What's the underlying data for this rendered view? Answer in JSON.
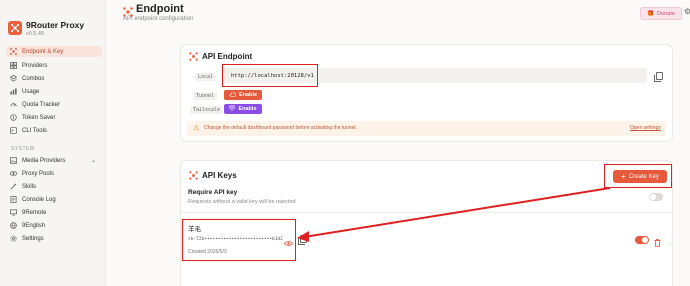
{
  "window": {
    "dot_colors": [
      "#ff5f57",
      "#febc2e",
      "#28c840"
    ]
  },
  "app": {
    "name": "9Router Proxy",
    "version": "v0.5.45",
    "accent": "#e8603c"
  },
  "sidebar": {
    "items": [
      {
        "label": "Endpoint & Key",
        "icon": "endpoint-icon",
        "active": true
      },
      {
        "label": "Providers",
        "icon": "grid-icon"
      },
      {
        "label": "Combos",
        "icon": "layers-icon"
      },
      {
        "label": "Usage",
        "icon": "bar-chart-icon"
      },
      {
        "label": "Quota Tracker",
        "icon": "gauge-icon"
      },
      {
        "label": "Token Saver",
        "icon": "coin-icon"
      },
      {
        "label": "CLI Tools",
        "icon": "terminal-icon"
      }
    ],
    "system_label": "SYSTEM",
    "system_items": [
      {
        "label": "Media Providers",
        "icon": "image-icon",
        "has_chevron": true
      },
      {
        "label": "Proxy Pools",
        "icon": "pool-icon"
      },
      {
        "label": "Skills",
        "icon": "wand-icon"
      },
      {
        "label": "Console Log",
        "icon": "console-icon"
      },
      {
        "label": "9Remote",
        "icon": "remote-icon"
      },
      {
        "label": "9English",
        "icon": "language-icon"
      },
      {
        "label": "Settings",
        "icon": "gear-icon"
      }
    ]
  },
  "header": {
    "title": "Endpoint",
    "subtitle": "API endpoint configuration",
    "donate_label": "Donate"
  },
  "api_endpoint": {
    "title": "API Endpoint",
    "local_label": "Local",
    "url": "http://localhost:20128/v1",
    "tunnel_label": "Tunnel",
    "tunnel_button": "Enable",
    "tailscale_label": "Tailscale",
    "tailscale_button": "Enable",
    "warning": "Change the default dashboard password before activating the tunnel.",
    "warning_link": "Open settings"
  },
  "api_keys": {
    "title": "API Keys",
    "create_button": "Create Key",
    "require_title": "Require API key",
    "require_desc": "Requests without a valid key will be rejected",
    "require_enabled": false,
    "key": {
      "name": "羊毛",
      "masked": "sk-72b•••••••••••••••••••••••••b1d2",
      "created": "Created 2026/5/3",
      "enabled": true
    }
  },
  "annotation_color": "#e02020"
}
